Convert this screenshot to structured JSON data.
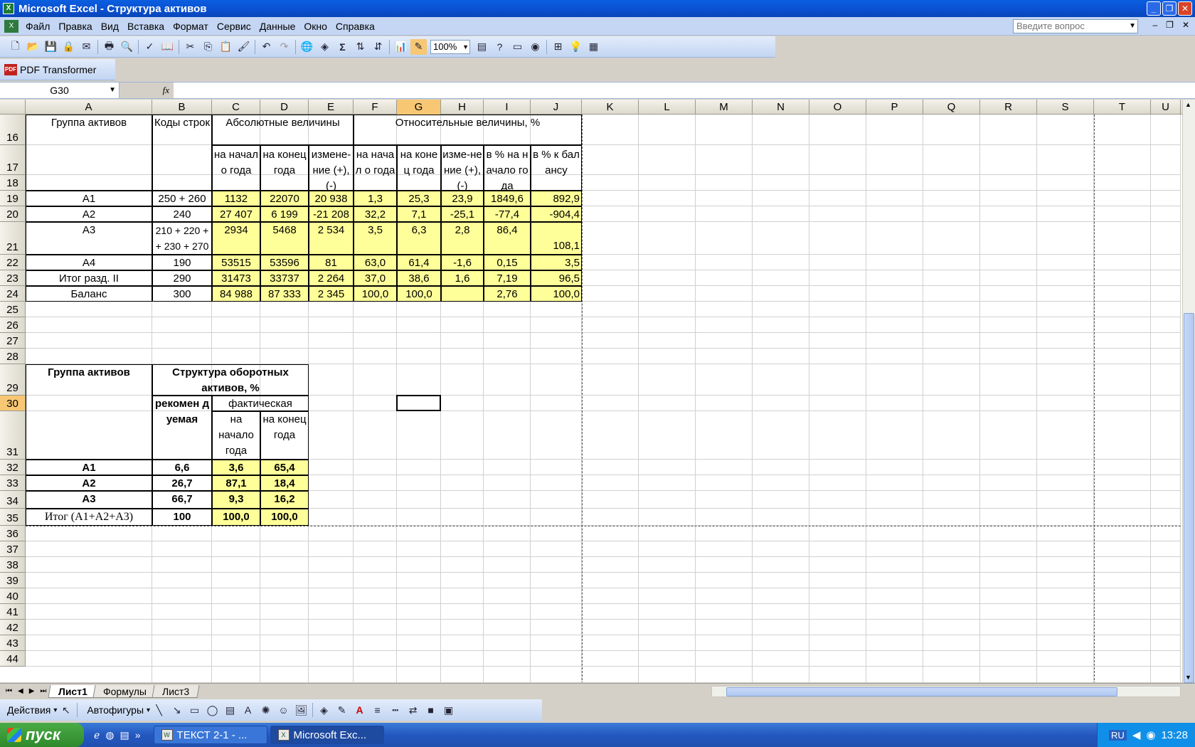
{
  "window": {
    "title": "Microsoft Excel - Структура активов",
    "app_icon": "excel-icon"
  },
  "menu": {
    "items": [
      "Файл",
      "Правка",
      "Вид",
      "Вставка",
      "Формат",
      "Сервис",
      "Данные",
      "Окно",
      "Справка"
    ],
    "help_placeholder": "Введите вопрос"
  },
  "toolbar": {
    "zoom": "100%",
    "pdf_label": "PDF Transformer"
  },
  "formula_bar": {
    "cell_ref": "G30",
    "fx": "fx",
    "value": ""
  },
  "columns": [
    "A",
    "B",
    "C",
    "D",
    "E",
    "F",
    "G",
    "H",
    "I",
    "J",
    "K",
    "L",
    "M",
    "N",
    "O",
    "P",
    "Q",
    "R",
    "S",
    "T",
    "U"
  ],
  "selected_column": "G",
  "selected_row": "30",
  "rows": [
    "16",
    "17",
    "18",
    "19",
    "20",
    "21",
    "22",
    "23",
    "24",
    "25",
    "26",
    "27",
    "28",
    "29",
    "30",
    "31",
    "32",
    "33",
    "34",
    "35",
    "36",
    "37",
    "38",
    "39",
    "40",
    "41",
    "42",
    "43",
    "44"
  ],
  "table1": {
    "h_group": "Группа активов",
    "h_codes": "Коды строк",
    "h_abs": "Абсолютные величины",
    "h_rel": "Относительные величины, %",
    "sub": [
      "на начало года",
      "на конец года",
      "измене-ние (+), (-)",
      "на начал о года",
      "на конец года",
      "изме-нение (+), (-)",
      "в % на начало года",
      "в % к балансу"
    ],
    "data": [
      [
        "А1",
        "250 + 260",
        "1132",
        "22070",
        "20 938",
        "1,3",
        "25,3",
        "23,9",
        "1849,6",
        "892,9"
      ],
      [
        "А2",
        "240",
        "27 407",
        "6 199",
        "-21 208",
        "32,2",
        "7,1",
        "-25,1",
        "-77,4",
        "-904,4"
      ],
      [
        "А3",
        "210 + 220 + + 230 + 270",
        "2934",
        "5468",
        "2 534",
        "3,5",
        "6,3",
        "2,8",
        "86,4",
        "108,1"
      ],
      [
        "А4",
        "190",
        "53515",
        "53596",
        "81",
        "63,0",
        "61,4",
        "-1,6",
        "0,15",
        "3,5"
      ],
      [
        "Итог разд. II",
        "290",
        "31473",
        "33737",
        "2 264",
        "37,0",
        "38,6",
        "1,6",
        "7,19",
        "96,5"
      ],
      [
        "Баланс",
        "300",
        "84 988",
        "87 333",
        "2 345",
        "100,0",
        "100,0",
        "",
        "2,76",
        "100,0"
      ]
    ]
  },
  "table2": {
    "h_group": "Группа активов",
    "h_struct": "Структура оборотных активов, %",
    "h_rec": "рекомен дуемая",
    "h_fact": "фактическая",
    "h_start": "на начало года",
    "h_end": "на конец года",
    "data": [
      [
        "А1",
        "6,6",
        "3,6",
        "65,4"
      ],
      [
        "А2",
        "26,7",
        "87,1",
        "18,4"
      ],
      [
        "А3",
        "66,7",
        "9,3",
        "16,2"
      ],
      [
        "Итог (А1+А2+А3)",
        "100",
        "100,0",
        "100,0"
      ]
    ]
  },
  "sheets": [
    "Лист1",
    "Формулы",
    "Лист3"
  ],
  "active_sheet": "Лист1",
  "drawing": {
    "actions": "Действия",
    "autoshapes": "Автофигуры"
  },
  "taskbar": {
    "start": "пуск",
    "tasks": [
      "ТЕКСТ 2-1 - ...",
      "Microsoft Exc..."
    ],
    "lang": "RU",
    "time": "13:28"
  },
  "colors": {
    "highlight": "#ffff99",
    "selection_header": "#f7c773",
    "titlebar": "#0a5fe0"
  }
}
